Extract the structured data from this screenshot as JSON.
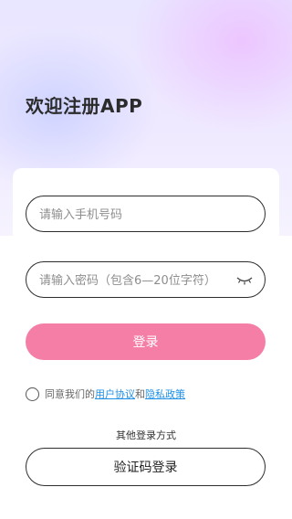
{
  "header": {
    "title": "欢迎注册APP"
  },
  "form": {
    "phone_placeholder": "请输入手机号码",
    "password_placeholder": "请输入密码（包含6—20位字符）",
    "login_label": "登录"
  },
  "agreement": {
    "prefix": "同意我们的",
    "user_agreement": "用户协议",
    "and": "和",
    "privacy_policy": "隐私政策"
  },
  "other_login": {
    "title": "其他登录方式",
    "code_login_label": "验证码登录"
  },
  "colors": {
    "accent": "#f57ea6",
    "link": "#1e90e8"
  }
}
